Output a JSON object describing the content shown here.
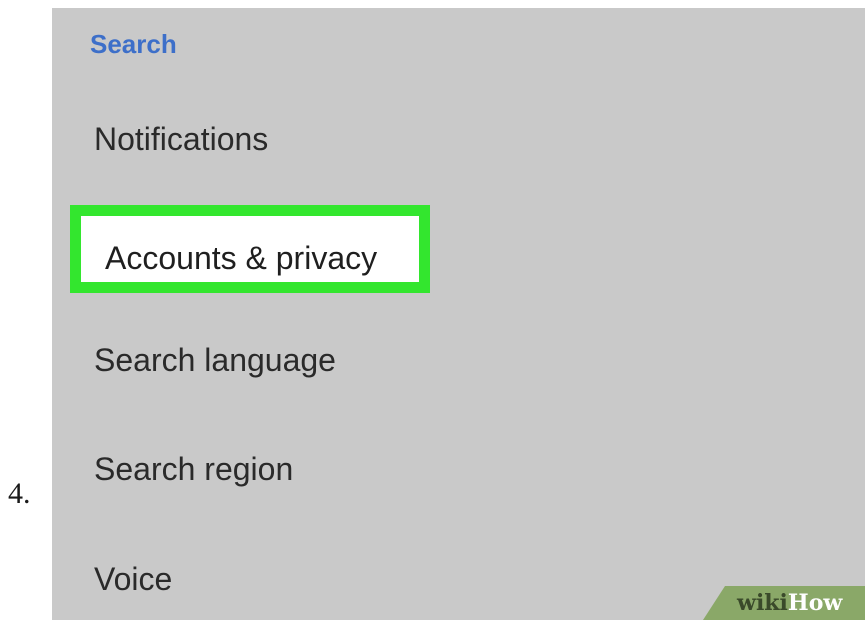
{
  "step": {
    "number": "4."
  },
  "settings": {
    "section_title": "Search",
    "items": [
      {
        "label": "Notifications"
      },
      {
        "label": "Accounts & privacy",
        "highlighted": true
      },
      {
        "label": "Search language"
      },
      {
        "label": "Search region"
      },
      {
        "label": "Voice"
      }
    ]
  },
  "watermark": {
    "part1": "wiki",
    "part2": "How"
  },
  "colors": {
    "screen_background": "#c9c9c9",
    "section_title": "#3d6fc9",
    "highlight": "#33e62e",
    "watermark_bg": "#8aa868"
  }
}
